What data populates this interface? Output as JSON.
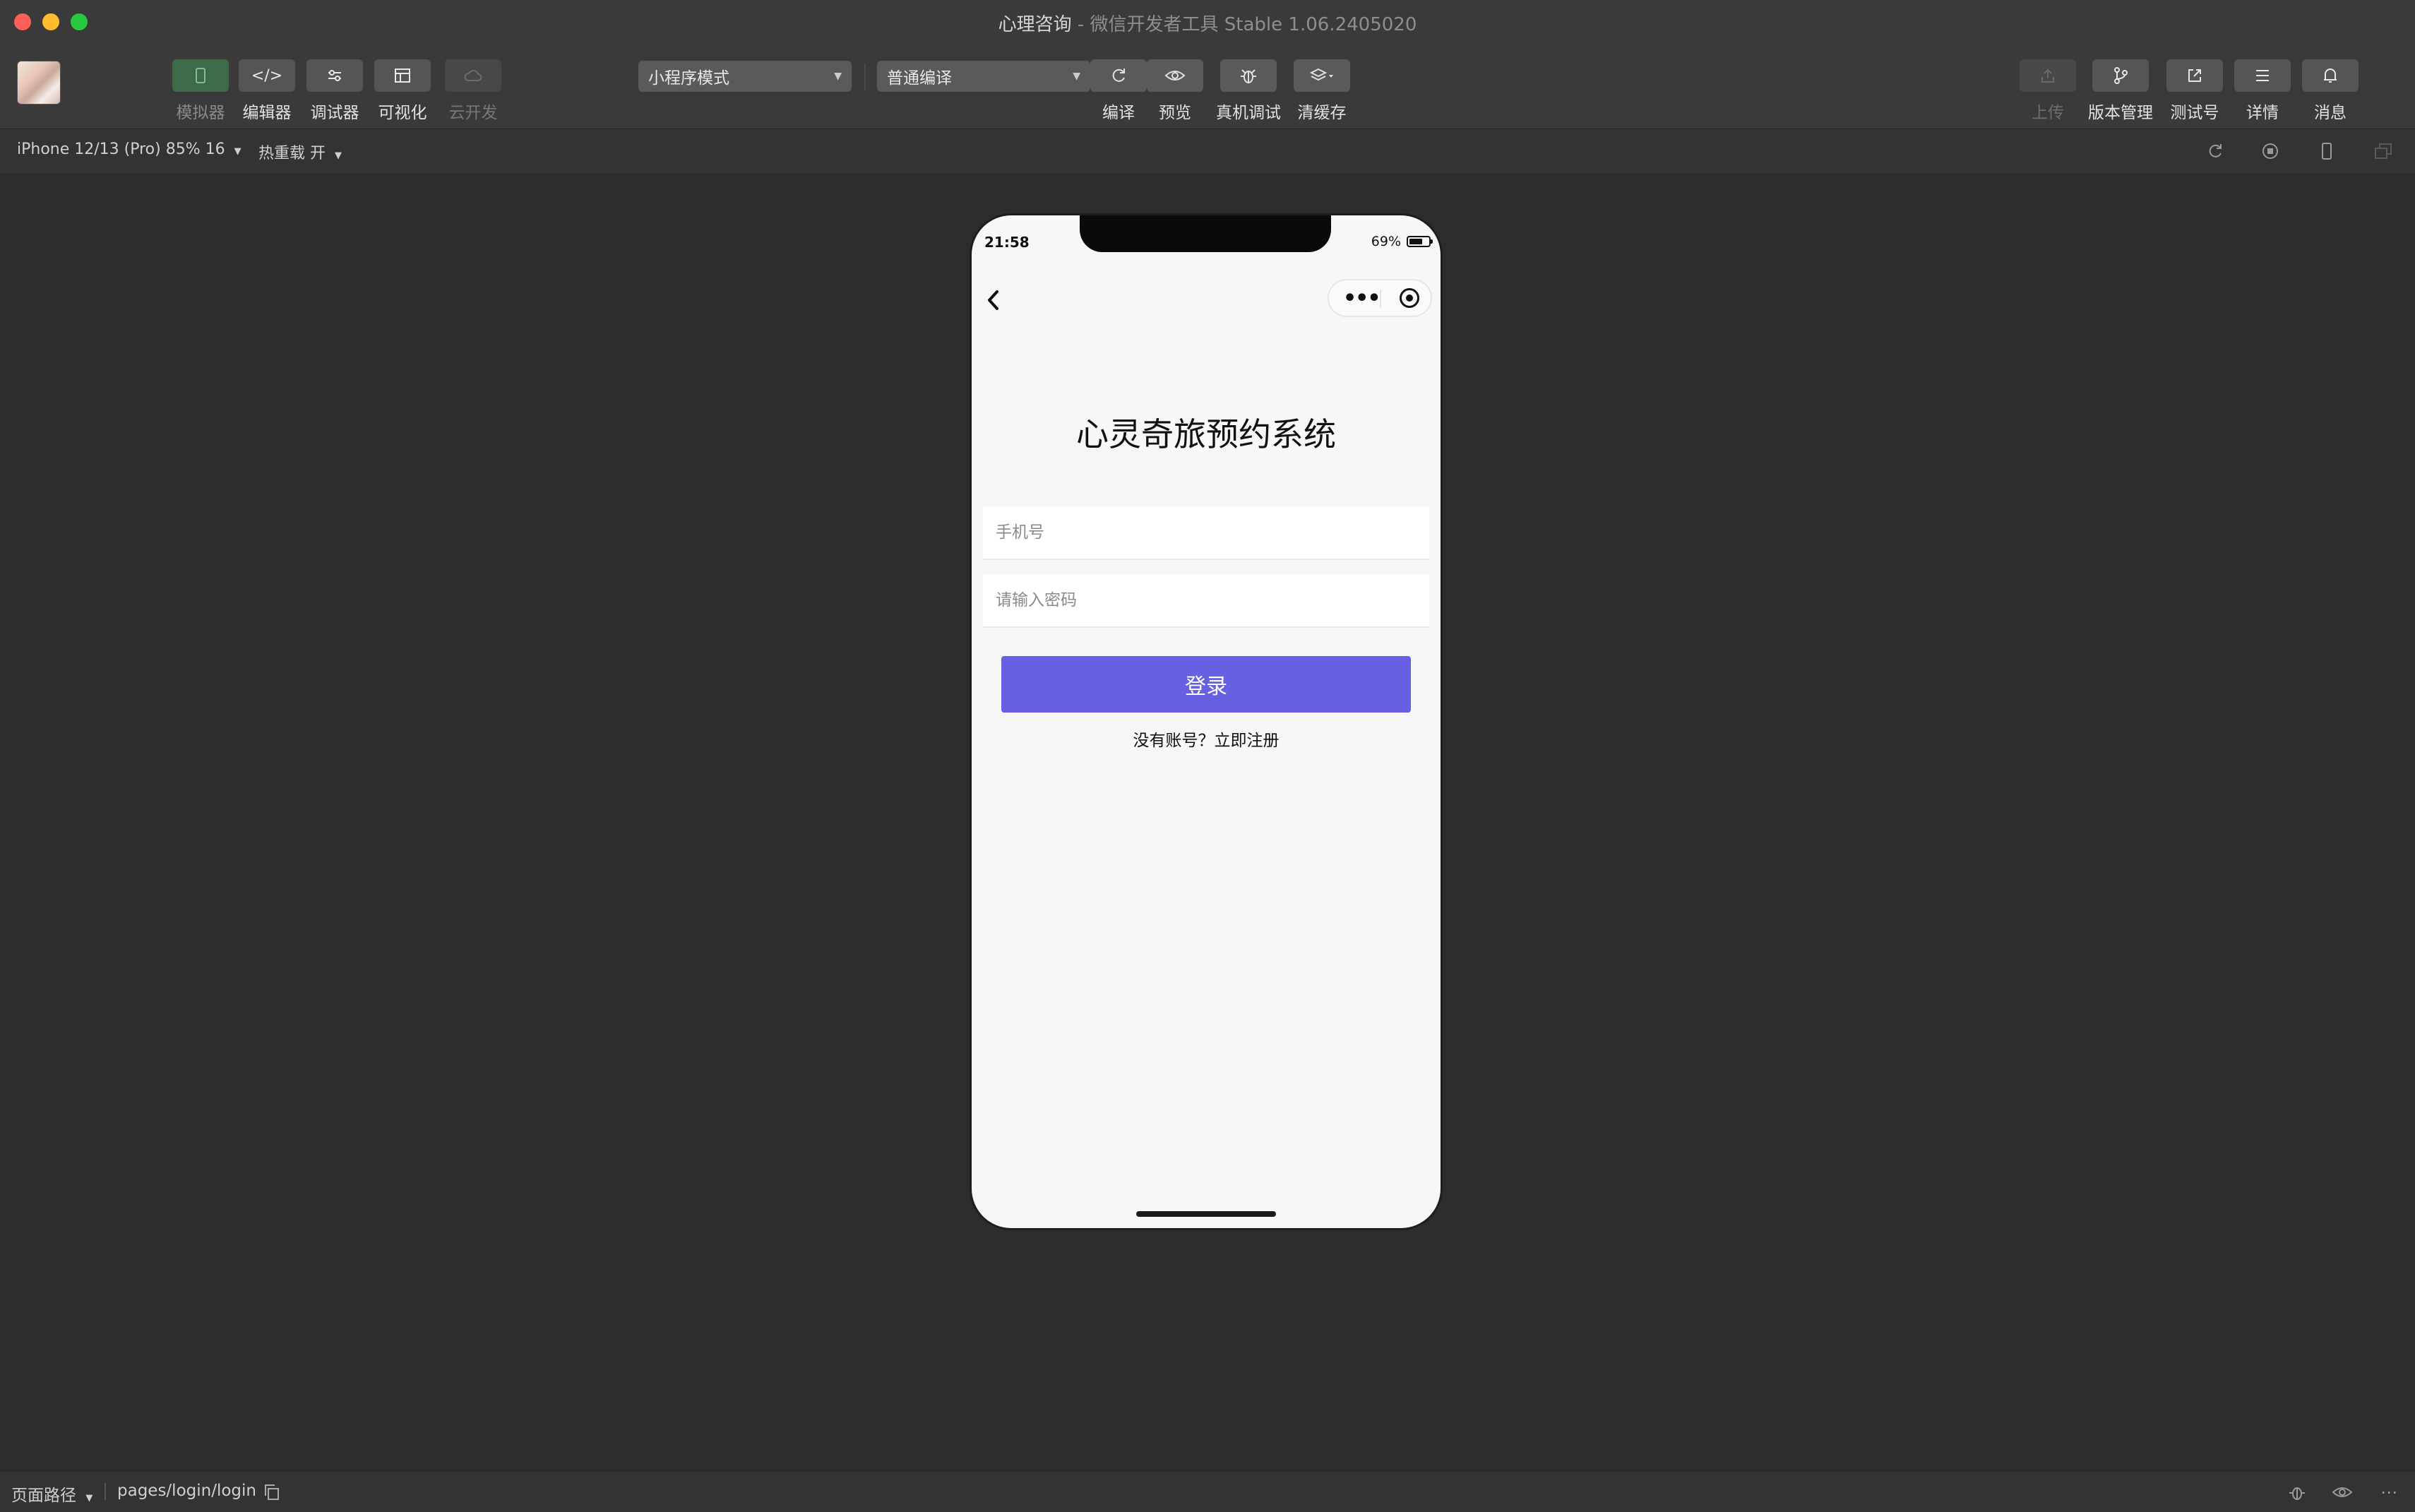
{
  "window": {
    "app_name": "心理咨询",
    "title_rest": " - 微信开发者工具 Stable 1.06.2405020"
  },
  "toolbar": {
    "left_tools": [
      {
        "label": "模拟器",
        "icon": "phone-icon"
      },
      {
        "label": "编辑器",
        "icon": "code-icon"
      },
      {
        "label": "调试器",
        "icon": "sliders-icon"
      },
      {
        "label": "可视化",
        "icon": "layout-icon"
      },
      {
        "label": "云开发",
        "icon": "cloud-icon"
      }
    ],
    "mode_select": "小程序模式",
    "compile_select": "普通编译",
    "mid_tools": [
      {
        "label": "编译",
        "icon": "refresh-icon"
      },
      {
        "label": "预览",
        "icon": "eye-icon"
      },
      {
        "label": "真机调试",
        "icon": "bug-icon"
      },
      {
        "label": "清缓存",
        "icon": "layers-icon"
      }
    ],
    "right_tools": [
      {
        "label": "上传",
        "icon": "upload-icon"
      },
      {
        "label": "版本管理",
        "icon": "branch-icon"
      },
      {
        "label": "测试号",
        "icon": "external-link-icon"
      },
      {
        "label": "详情",
        "icon": "menu-icon"
      },
      {
        "label": "消息",
        "icon": "bell-icon"
      }
    ]
  },
  "subbar": {
    "device": "iPhone 12/13 (Pro) 85% 16",
    "hot_reload": "热重载 开"
  },
  "phone": {
    "time": "21:58",
    "battery": "69%",
    "battery_level": 0.69,
    "page_title": "心灵奇旅预约系统",
    "phone_placeholder": "手机号",
    "password_placeholder": "请输入密码",
    "login_label": "登录",
    "register_link": "没有账号？立即注册",
    "button_color": "#6760e2"
  },
  "bottombar": {
    "path_label": "页面路径",
    "path_value": "pages/login/login"
  }
}
